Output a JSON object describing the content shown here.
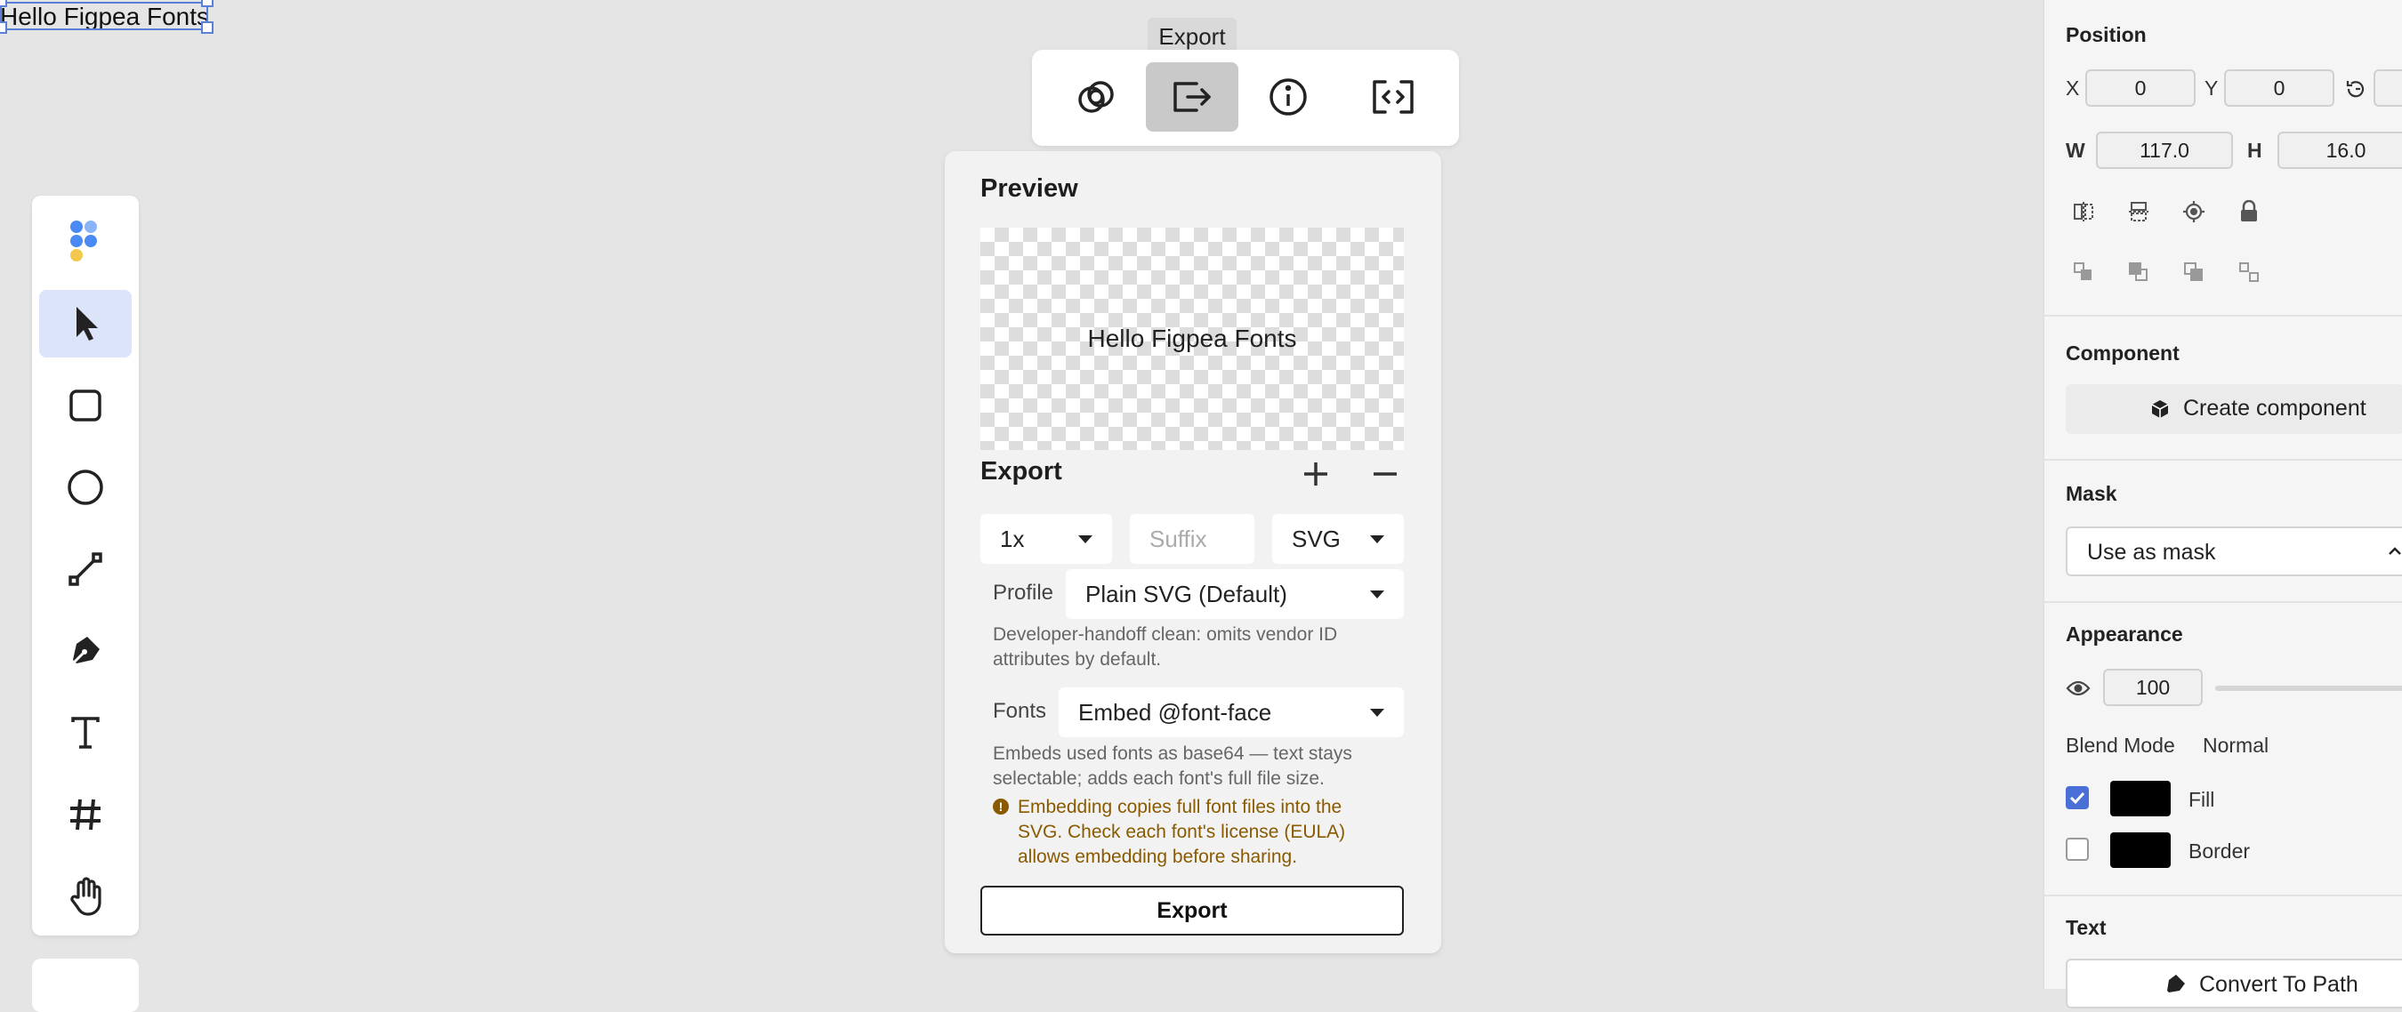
{
  "canvas": {
    "text": "Hello Figpea Fonts"
  },
  "tooltip": {
    "label": "Export"
  },
  "top_toolbar": {
    "items": [
      {
        "icon": "boolean-icon",
        "active": false
      },
      {
        "icon": "export-icon",
        "active": true
      },
      {
        "icon": "info-icon",
        "active": false
      },
      {
        "icon": "code-icon",
        "active": false
      }
    ]
  },
  "tools": [
    {
      "icon": "logo-icon"
    },
    {
      "icon": "cursor-icon",
      "active": true
    },
    {
      "icon": "rectangle-icon"
    },
    {
      "icon": "ellipse-icon"
    },
    {
      "icon": "line-icon"
    },
    {
      "icon": "pen-icon"
    },
    {
      "icon": "text-tool-icon"
    },
    {
      "icon": "frame-icon"
    },
    {
      "icon": "hand-icon"
    }
  ],
  "export_panel": {
    "preview_title": "Preview",
    "preview_text": "Hello Figpea Fonts",
    "export_title": "Export",
    "scale": "1x",
    "suffix_placeholder": "Suffix",
    "format": "SVG",
    "profile_label": "Profile",
    "profile_value": "Plain SVG (Default)",
    "profile_help_1": "Developer-handoff clean: omits vendor ID",
    "profile_help_2": "attributes by default.",
    "fonts_label": "Fonts",
    "fonts_value": "Embed @font-face",
    "fonts_help_1": "Embeds used fonts as base64 — text stays",
    "fonts_help_2": "selectable; adds each font's full file size.",
    "warning_1": "Embedding copies full font files into the",
    "warning_2": "SVG. Check each font's license (EULA)",
    "warning_3": "allows embedding before sharing.",
    "export_button": "Export"
  },
  "right_panel": {
    "position_title": "Position",
    "x_label": "X",
    "x_value": "0",
    "y_label": "Y",
    "y_value": "0",
    "w_label": "W",
    "w_value": "117.0",
    "h_label": "H",
    "h_value": "16.0",
    "component_title": "Component",
    "create_component": "Create component",
    "mask_title": "Mask",
    "mask_value": "Use as mask",
    "appearance_title": "Appearance",
    "opacity_value": "100",
    "blend_label": "Blend Mode",
    "blend_value": "Normal",
    "fill_label": "Fill",
    "fill_checked": true,
    "fill_color": "#000000",
    "border_label": "Border",
    "border_checked": false,
    "border_color": "#000000",
    "text_title": "Text",
    "convert_to_path": "Convert To Path"
  },
  "colors": {
    "accent": "#4a6fd6",
    "warning": "#8a5a00",
    "selection": "#5a7fd6"
  }
}
